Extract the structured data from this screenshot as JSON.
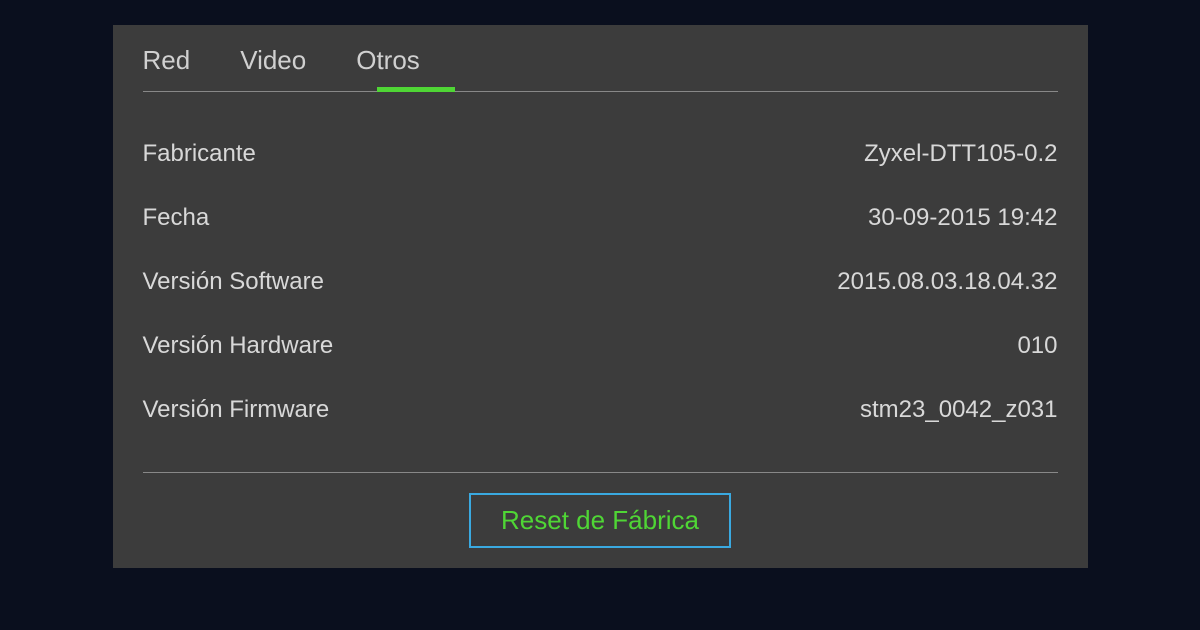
{
  "tabs": {
    "red": "Red",
    "video": "Video",
    "otros": "Otros"
  },
  "info": {
    "fabricante_label": "Fabricante",
    "fabricante_value": "Zyxel-DTT105-0.2",
    "fecha_label": "Fecha",
    "fecha_value": "30-09-2015 19:42",
    "version_software_label": "Versión Software",
    "version_software_value": "2015.08.03.18.04.32",
    "version_hardware_label": "Versión Hardware",
    "version_hardware_value": "010",
    "version_firmware_label": "Versión Firmware",
    "version_firmware_value": "stm23_0042_z031"
  },
  "button": {
    "reset_label": "Reset de Fábrica"
  }
}
